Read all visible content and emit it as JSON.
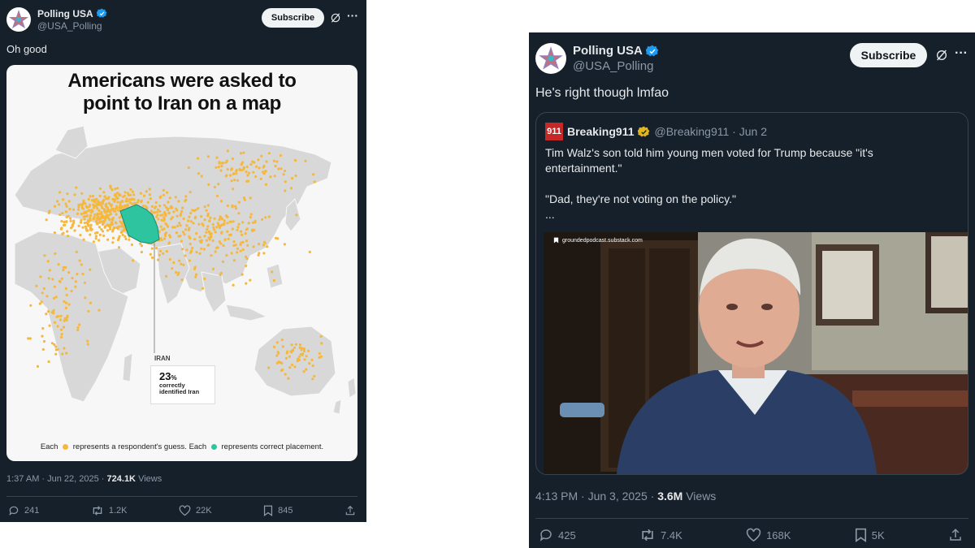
{
  "tweet1": {
    "author": {
      "display_name": "Polling USA",
      "handle": "@USA_Polling",
      "verified": true
    },
    "subscribe_label": "Subscribe",
    "text": "Oh good",
    "map": {
      "title_line1": "Americans were asked to",
      "title_line2": "point to Iran on a map",
      "callout_label": "IRAN",
      "callout_value": "23",
      "callout_unit": "%",
      "callout_text1": "correctly",
      "callout_text2": "identified Iran",
      "legend_each1": "Each",
      "legend_guess": "represents a respondent's guess. Each",
      "legend_correct": "represents correct placement.",
      "guess_color": "#f5b83d",
      "correct_color": "#2ec4a0"
    },
    "time": "1:37 AM · Jun 22, 2025 ·",
    "views_count": "724.1K",
    "views_label": "Views",
    "replies": "241",
    "reposts": "1.2K",
    "likes": "22K",
    "bookmarks": "845"
  },
  "tweet2": {
    "author": {
      "display_name": "Polling USA",
      "handle": "@USA_Polling",
      "verified": true
    },
    "subscribe_label": "Subscribe",
    "text": "He's right though lmfao",
    "quote": {
      "logo_text": "911",
      "display_name": "Breaking911",
      "handle_date": "@Breaking911 · Jun 2",
      "line1": "Tim Walz's son told him young men voted for Trump because \"it's entertainment.\"",
      "line2": "\"Dad, they're not voting on the policy.\"",
      "ellipsis": "...",
      "video_source": "groundedpodcast.substack.com"
    },
    "time": "4:13 PM · Jun 3, 2025 ·",
    "views_count": "3.6M",
    "views_label": "Views",
    "replies": "425",
    "reposts": "7.4K",
    "likes": "168K",
    "bookmarks": "5K"
  },
  "colors": {
    "background": "#15202b",
    "text": "#e7e9ea",
    "muted": "#8b98a5",
    "verified": "#1d9bf0",
    "gold_check": "#e2b719"
  }
}
